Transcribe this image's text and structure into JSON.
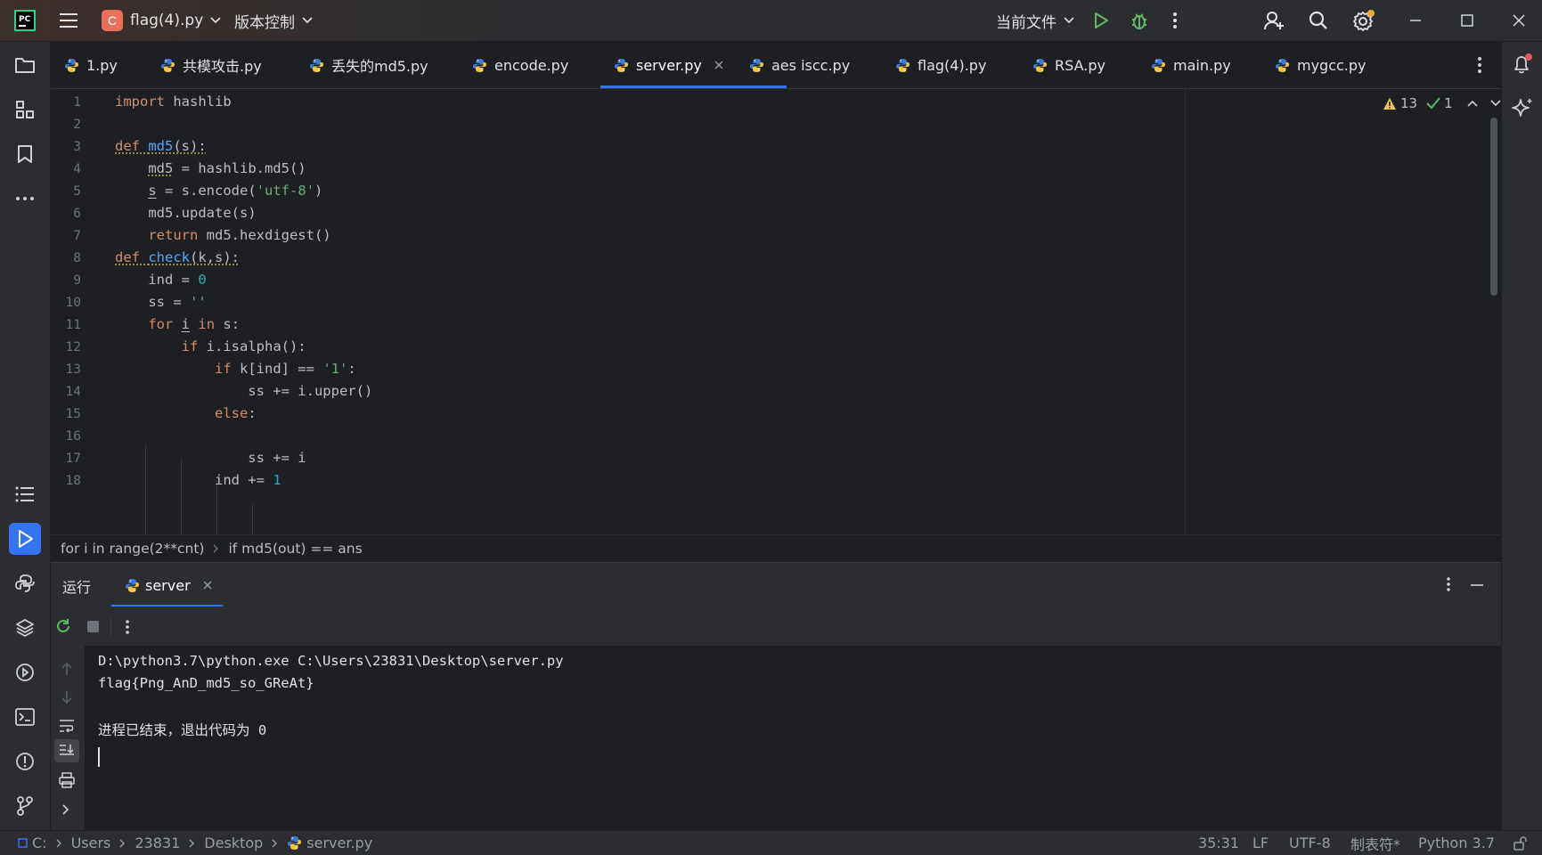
{
  "titlebar": {
    "project_badge": "C",
    "project_name": "flag(4).py",
    "vcs": "版本控制",
    "run_config": "当前文件"
  },
  "tabs": [
    {
      "label": "1.py"
    },
    {
      "label": "共模攻击.py"
    },
    {
      "label": "丢失的md5.py"
    },
    {
      "label": "encode.py"
    },
    {
      "label": "server.py",
      "active": true
    },
    {
      "label": "aes iscc.py"
    },
    {
      "label": "flag(4).py"
    },
    {
      "label": "RSA.py"
    },
    {
      "label": "main.py"
    },
    {
      "label": "mygcc.py"
    }
  ],
  "inspections": {
    "warnings": "13",
    "ok": "1"
  },
  "editor": {
    "line_numbers": [
      "1",
      "2",
      "3",
      "4",
      "5",
      "6",
      "7",
      "8",
      "9",
      "10",
      "11",
      "12",
      "13",
      "14",
      "15",
      "16",
      "17",
      "18"
    ],
    "lines": [
      "import hashlib",
      "",
      "def md5(s):",
      "    md5 = hashlib.md5()",
      "    s = s.encode('utf-8')",
      "    md5.update(s)",
      "    return md5.hexdigest()",
      "def check(k,s):",
      "    ind = 0",
      "    ss = ''",
      "    for i in s:",
      "        if i.isalpha():",
      "            if k[ind] == '1':",
      "                ss += i.upper()",
      "            else:",
      "",
      "                ss += i",
      "            ind += 1"
    ]
  },
  "breadcrumb": [
    "for i in range(2**cnt)",
    "if md5(out) == ans"
  ],
  "run_panel": {
    "tab_run": "运行",
    "tab_server": "server",
    "console": [
      "D:\\python3.7\\python.exe C:\\Users\\23831\\Desktop\\server.py",
      "flag{Png_AnD_md5_so_GReAt}",
      "",
      "进程已结束，退出代码为 0"
    ]
  },
  "statusbar": {
    "path": [
      "C:",
      "Users",
      "23831",
      "Desktop",
      "server.py"
    ],
    "position": "35:31",
    "line_sep": "LF",
    "encoding": "UTF-8",
    "indent": "制表符*",
    "interpreter": "Python 3.7"
  },
  "colors": {
    "accent": "#3574f0",
    "keyword": "#cf8e6d",
    "function": "#56a8f5",
    "string": "#6aab73",
    "number": "#2aacb8"
  }
}
